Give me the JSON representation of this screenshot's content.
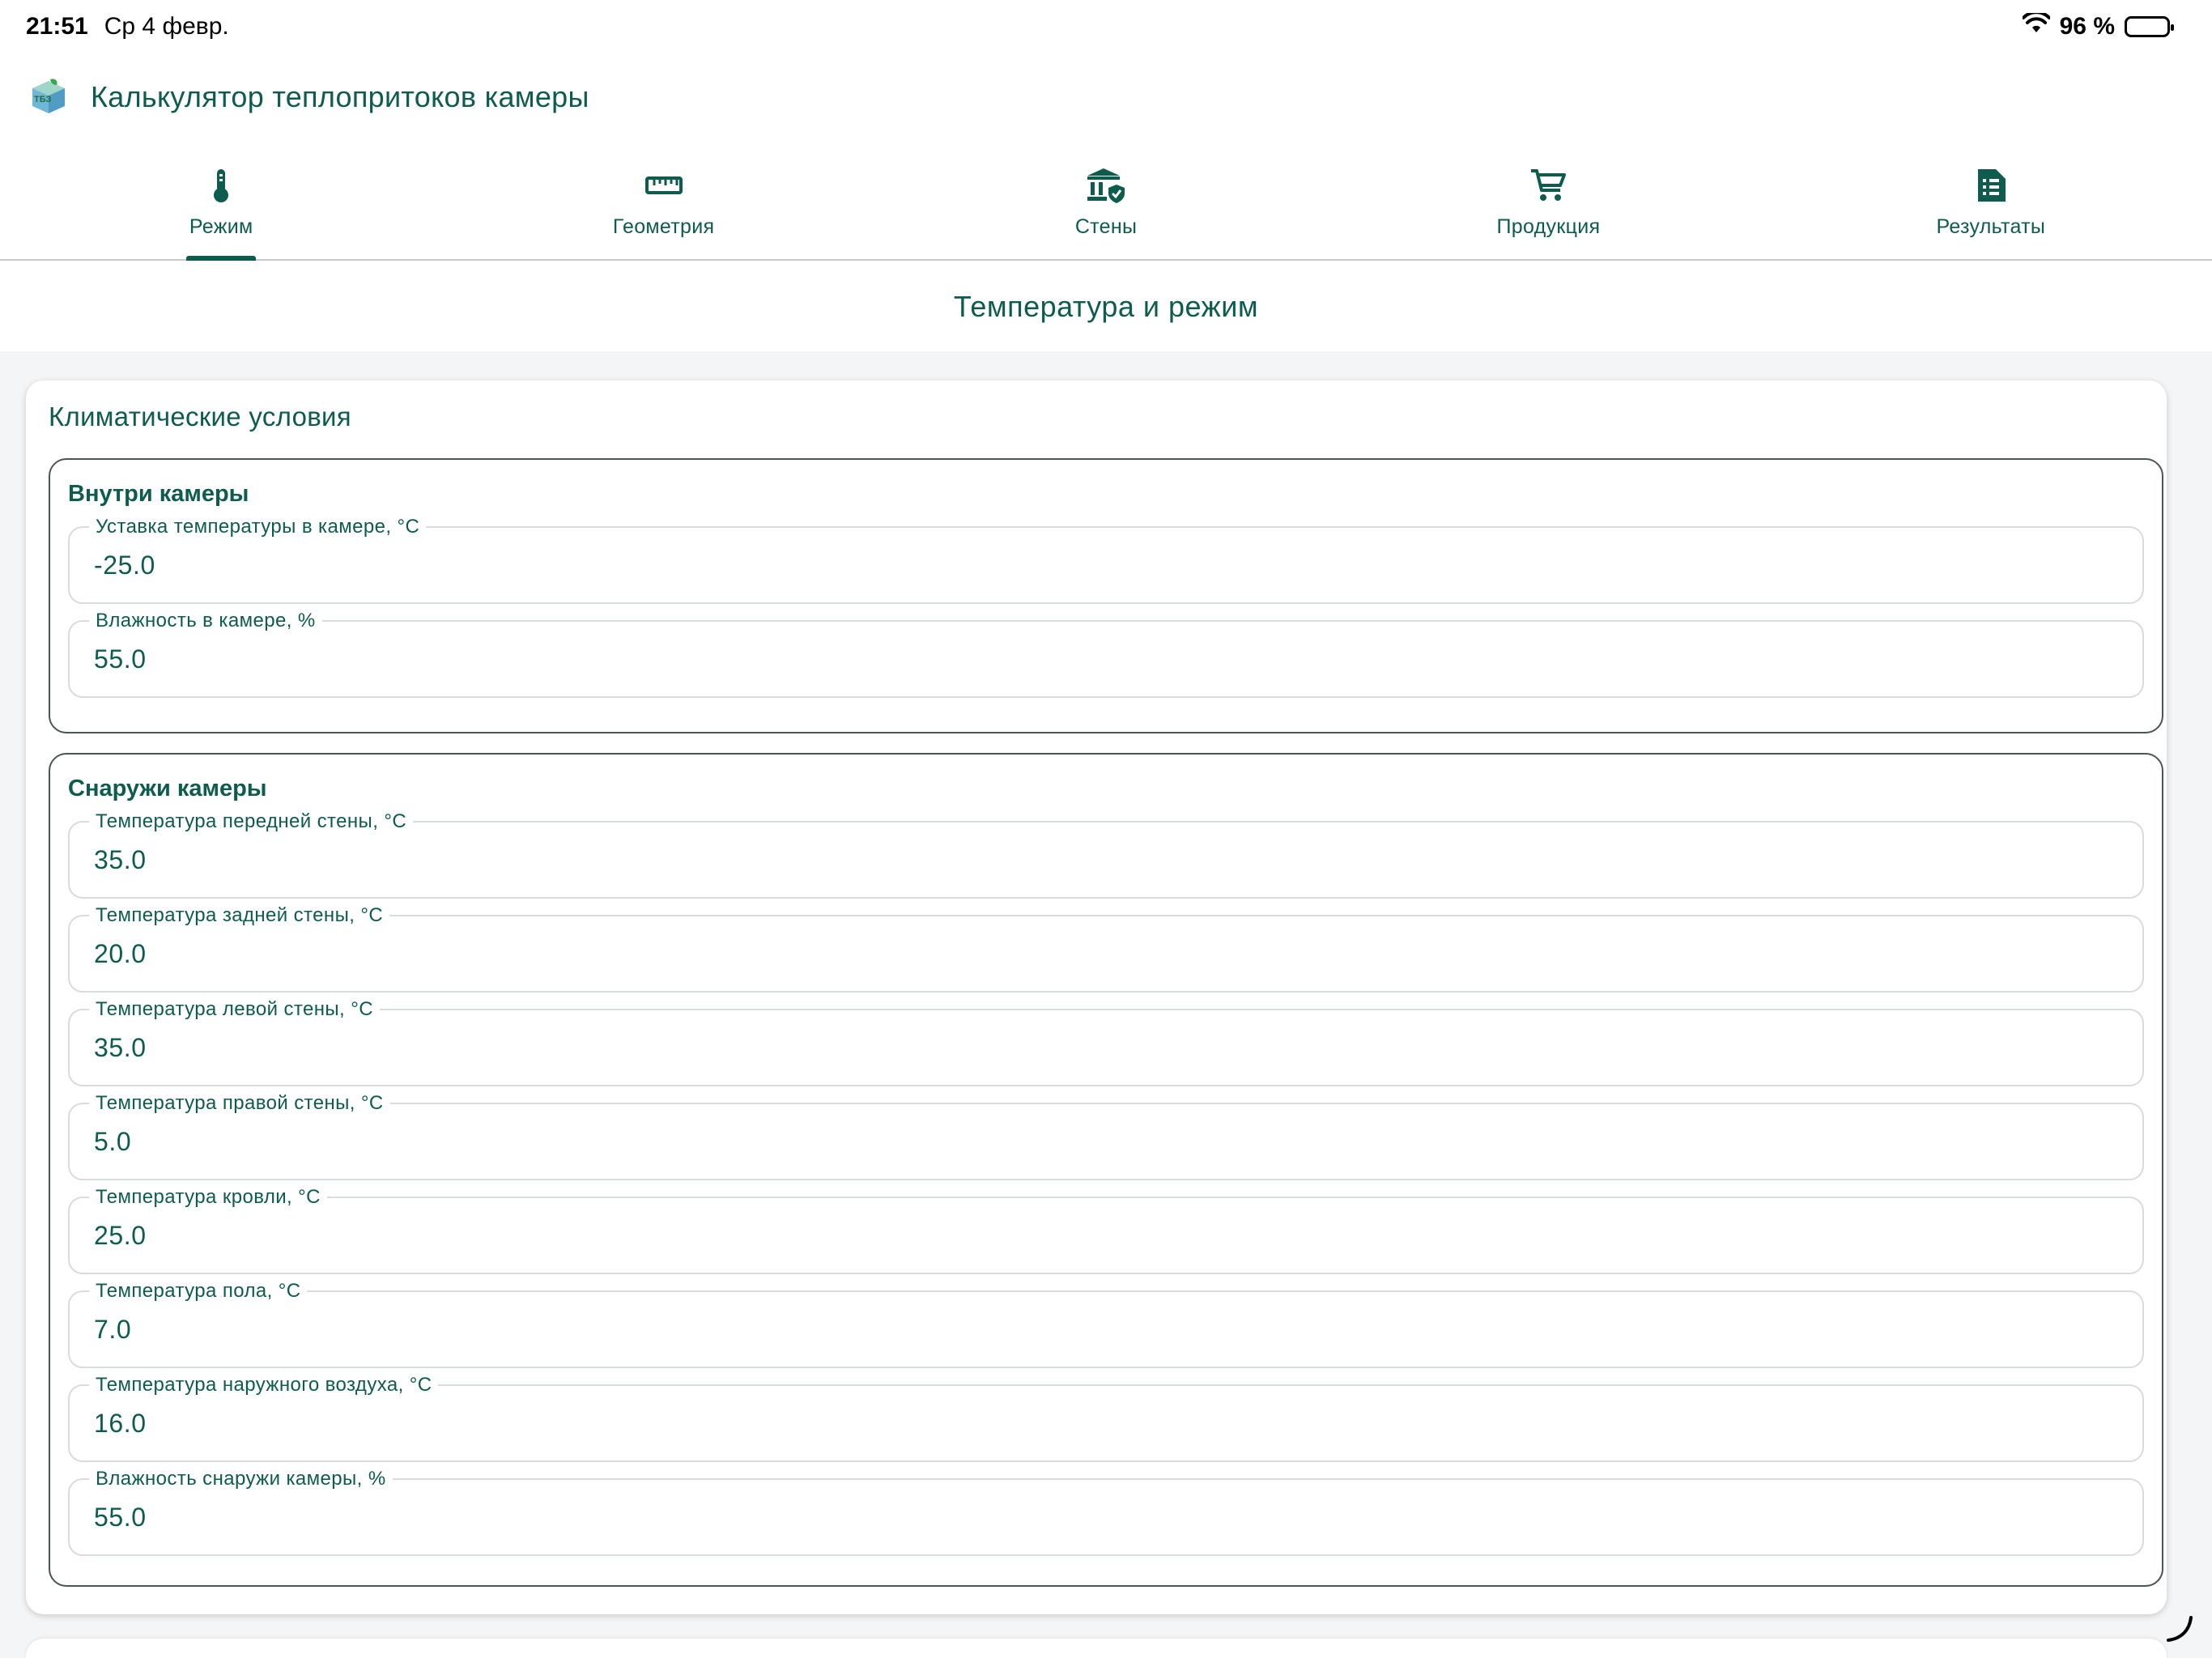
{
  "status_bar": {
    "time": "21:51",
    "date": "Ср 4 февр.",
    "battery": "96 %",
    "battery_level": 0.96
  },
  "app": {
    "title": "Калькулятор теплопритоков камеры",
    "logo_text": "ТБЗ"
  },
  "tabs": [
    {
      "label": "Режим",
      "icon": "thermometer-icon",
      "active": true
    },
    {
      "label": "Геометрия",
      "icon": "ruler-icon",
      "active": false
    },
    {
      "label": "Стены",
      "icon": "building-shield-icon",
      "active": false
    },
    {
      "label": "Продукция",
      "icon": "cart-icon",
      "active": false
    },
    {
      "label": "Результаты",
      "icon": "report-icon",
      "active": false
    }
  ],
  "page": {
    "title": "Температура и режим"
  },
  "card": {
    "title": "Климатические условия",
    "inside": {
      "title": "Внутри камеры",
      "fields": [
        {
          "label": "Уставка температуры в камере, °C",
          "value": "-25.0"
        },
        {
          "label": "Влажность в камере, %",
          "value": "55.0"
        }
      ]
    },
    "outside": {
      "title": "Снаружи камеры",
      "fields": [
        {
          "label": "Температура передней стены, °C",
          "value": "35.0"
        },
        {
          "label": "Температура задней стены, °C",
          "value": "20.0"
        },
        {
          "label": "Температура левой стены, °C",
          "value": "35.0"
        },
        {
          "label": "Температура правой стены, °C",
          "value": "5.0"
        },
        {
          "label": "Температура кровли, °C",
          "value": "25.0"
        },
        {
          "label": "Температура пола, °C",
          "value": "7.0"
        },
        {
          "label": "Температура наружного воздуха, °C",
          "value": "16.0"
        },
        {
          "label": "Влажность снаружи камеры, %",
          "value": "55.0"
        }
      ]
    }
  },
  "colors": {
    "accent": "#0d5c4e",
    "background": "#f4f5f6",
    "group_border": "#4b5553",
    "field_border": "#d8dcdb"
  }
}
